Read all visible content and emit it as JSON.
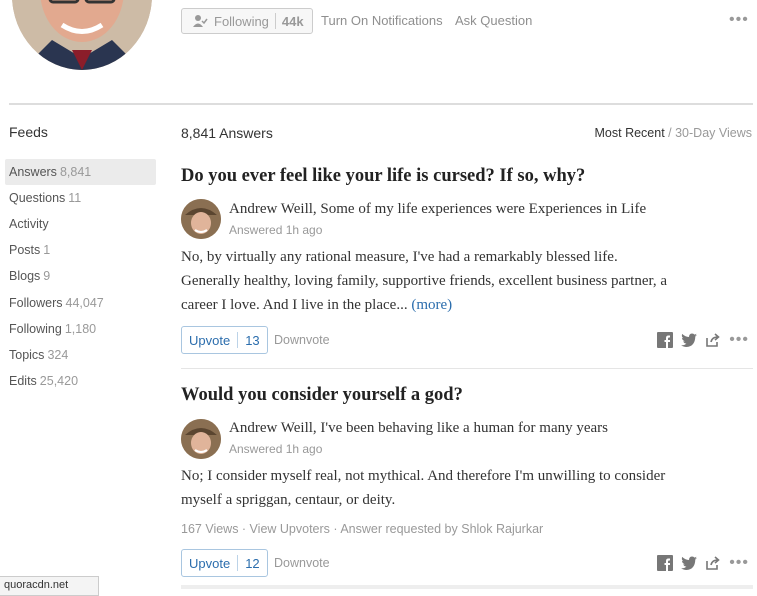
{
  "profile": {
    "follow_label": "Following",
    "follower_count": "44k",
    "notifications_label": "Turn On Notifications",
    "ask_label": "Ask Question",
    "more_label": "•••"
  },
  "sidebar": {
    "title": "Feeds",
    "items": [
      {
        "label": "Answers",
        "count": "8,841"
      },
      {
        "label": "Questions",
        "count": "11"
      },
      {
        "label": "Activity",
        "count": ""
      },
      {
        "label": "Posts",
        "count": "1"
      },
      {
        "label": "Blogs",
        "count": "9"
      },
      {
        "label": "Followers",
        "count": "44,047"
      },
      {
        "label": "Following",
        "count": "1,180"
      },
      {
        "label": "Topics",
        "count": "324"
      },
      {
        "label": "Edits",
        "count": "25,420"
      }
    ]
  },
  "main": {
    "answers_count": "8,841 Answers",
    "sort_active": "Most Recent",
    "sort_sep": " / ",
    "sort_alt": "30-Day Views",
    "answers": [
      {
        "question": "Do you ever feel like your life is cursed? If so, why?",
        "author": "Andrew Weill, Some of my life experiences were Experiences in Life",
        "answered": "Answered 1h ago",
        "lines": [
          "No, by virtually any rational measure, I've had a remarkably blessed life.",
          "Generally healthy, loving family, supportive friends, excellent business partner, a",
          "career I love. And I live in the place..."
        ],
        "more": "(more)",
        "upvote_label": "Upvote",
        "upvote_count": "13",
        "downvote_label": "Downvote"
      },
      {
        "question": "Would you consider yourself a god?",
        "author": "Andrew Weill, I've been behaving like a human for many years",
        "answered": "Answered 1h ago",
        "lines": [
          "No; I consider myself real, not mythical. And therefore I'm unwilling to consider",
          "myself a spriggan, centaur, or deity."
        ],
        "meta": "167 Views · View Upvoters · Answer requested by Shlok Rajurkar",
        "upvote_label": "Upvote",
        "upvote_count": "12",
        "downvote_label": "Downvote"
      }
    ]
  },
  "status_bar": "quoracdn.net",
  "colors": {
    "link": "#2b6dad",
    "muted": "#999999",
    "divider": "#dddddd"
  }
}
